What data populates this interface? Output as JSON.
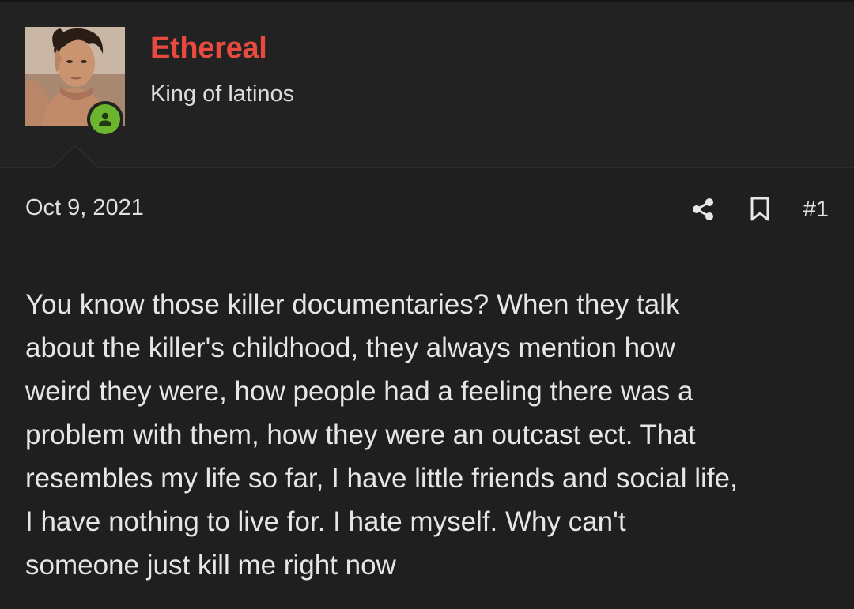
{
  "post": {
    "author": {
      "name": "Ethereal",
      "title": "King of latinos",
      "status": "online",
      "name_color": "#e84a3f",
      "status_color": "#6bb52f"
    },
    "date": "Oct 9, 2021",
    "number": "#1",
    "actions": [
      {
        "name": "share",
        "icon": "share-icon"
      },
      {
        "name": "bookmark",
        "icon": "bookmark-icon"
      }
    ],
    "body_lines": [
      "You know those killer documentaries? When they talk",
      "about the killer's childhood, they always mention how",
      "weird they were, how people had a feeling there was a",
      "problem with them, how they were an outcast ect. That",
      "resembles my life so far, I have little friends and social life,",
      "I have nothing to live for. I hate myself. Why can't",
      "someone just kill me right now"
    ]
  },
  "colors": {
    "background": "#1f1f1f",
    "header_background": "#222222",
    "text": "#e6e6e6"
  }
}
